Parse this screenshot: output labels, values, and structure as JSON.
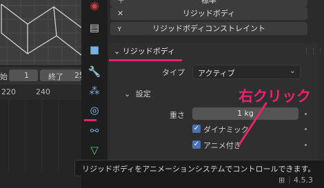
{
  "timeline": {
    "start_label": "始",
    "start_value": "1",
    "end_label": "終了",
    "end_value": "25",
    "ruler_ticks": [
      "220",
      "240"
    ]
  },
  "properties": {
    "top_buttons": [
      {
        "label": "標準",
        "icon": "add-icon"
      },
      {
        "label": "リジッドボディ",
        "icon": "close-icon"
      },
      {
        "label": "リジッドボディコンストレイント",
        "icon": "constraint-icon"
      }
    ],
    "rigid_body_panel": {
      "title": "リジッドボディ",
      "type_label": "タイプ",
      "type_value": "アクティブ",
      "settings": {
        "title": "設定",
        "mass_label": "重さ",
        "mass_value": "1 kg",
        "dynamic_label": "ダイナミック",
        "dynamic_checked": true,
        "animated_label": "アニメ付き",
        "animated_checked": true
      }
    }
  },
  "annotation": {
    "callout_text": "右クリック",
    "accent_color": "#e6246e"
  },
  "tooltip": {
    "text": "リジッドボディをアニメーションシステムでコントロールできます。"
  },
  "status_bar": {
    "version": "4.5.3"
  }
}
